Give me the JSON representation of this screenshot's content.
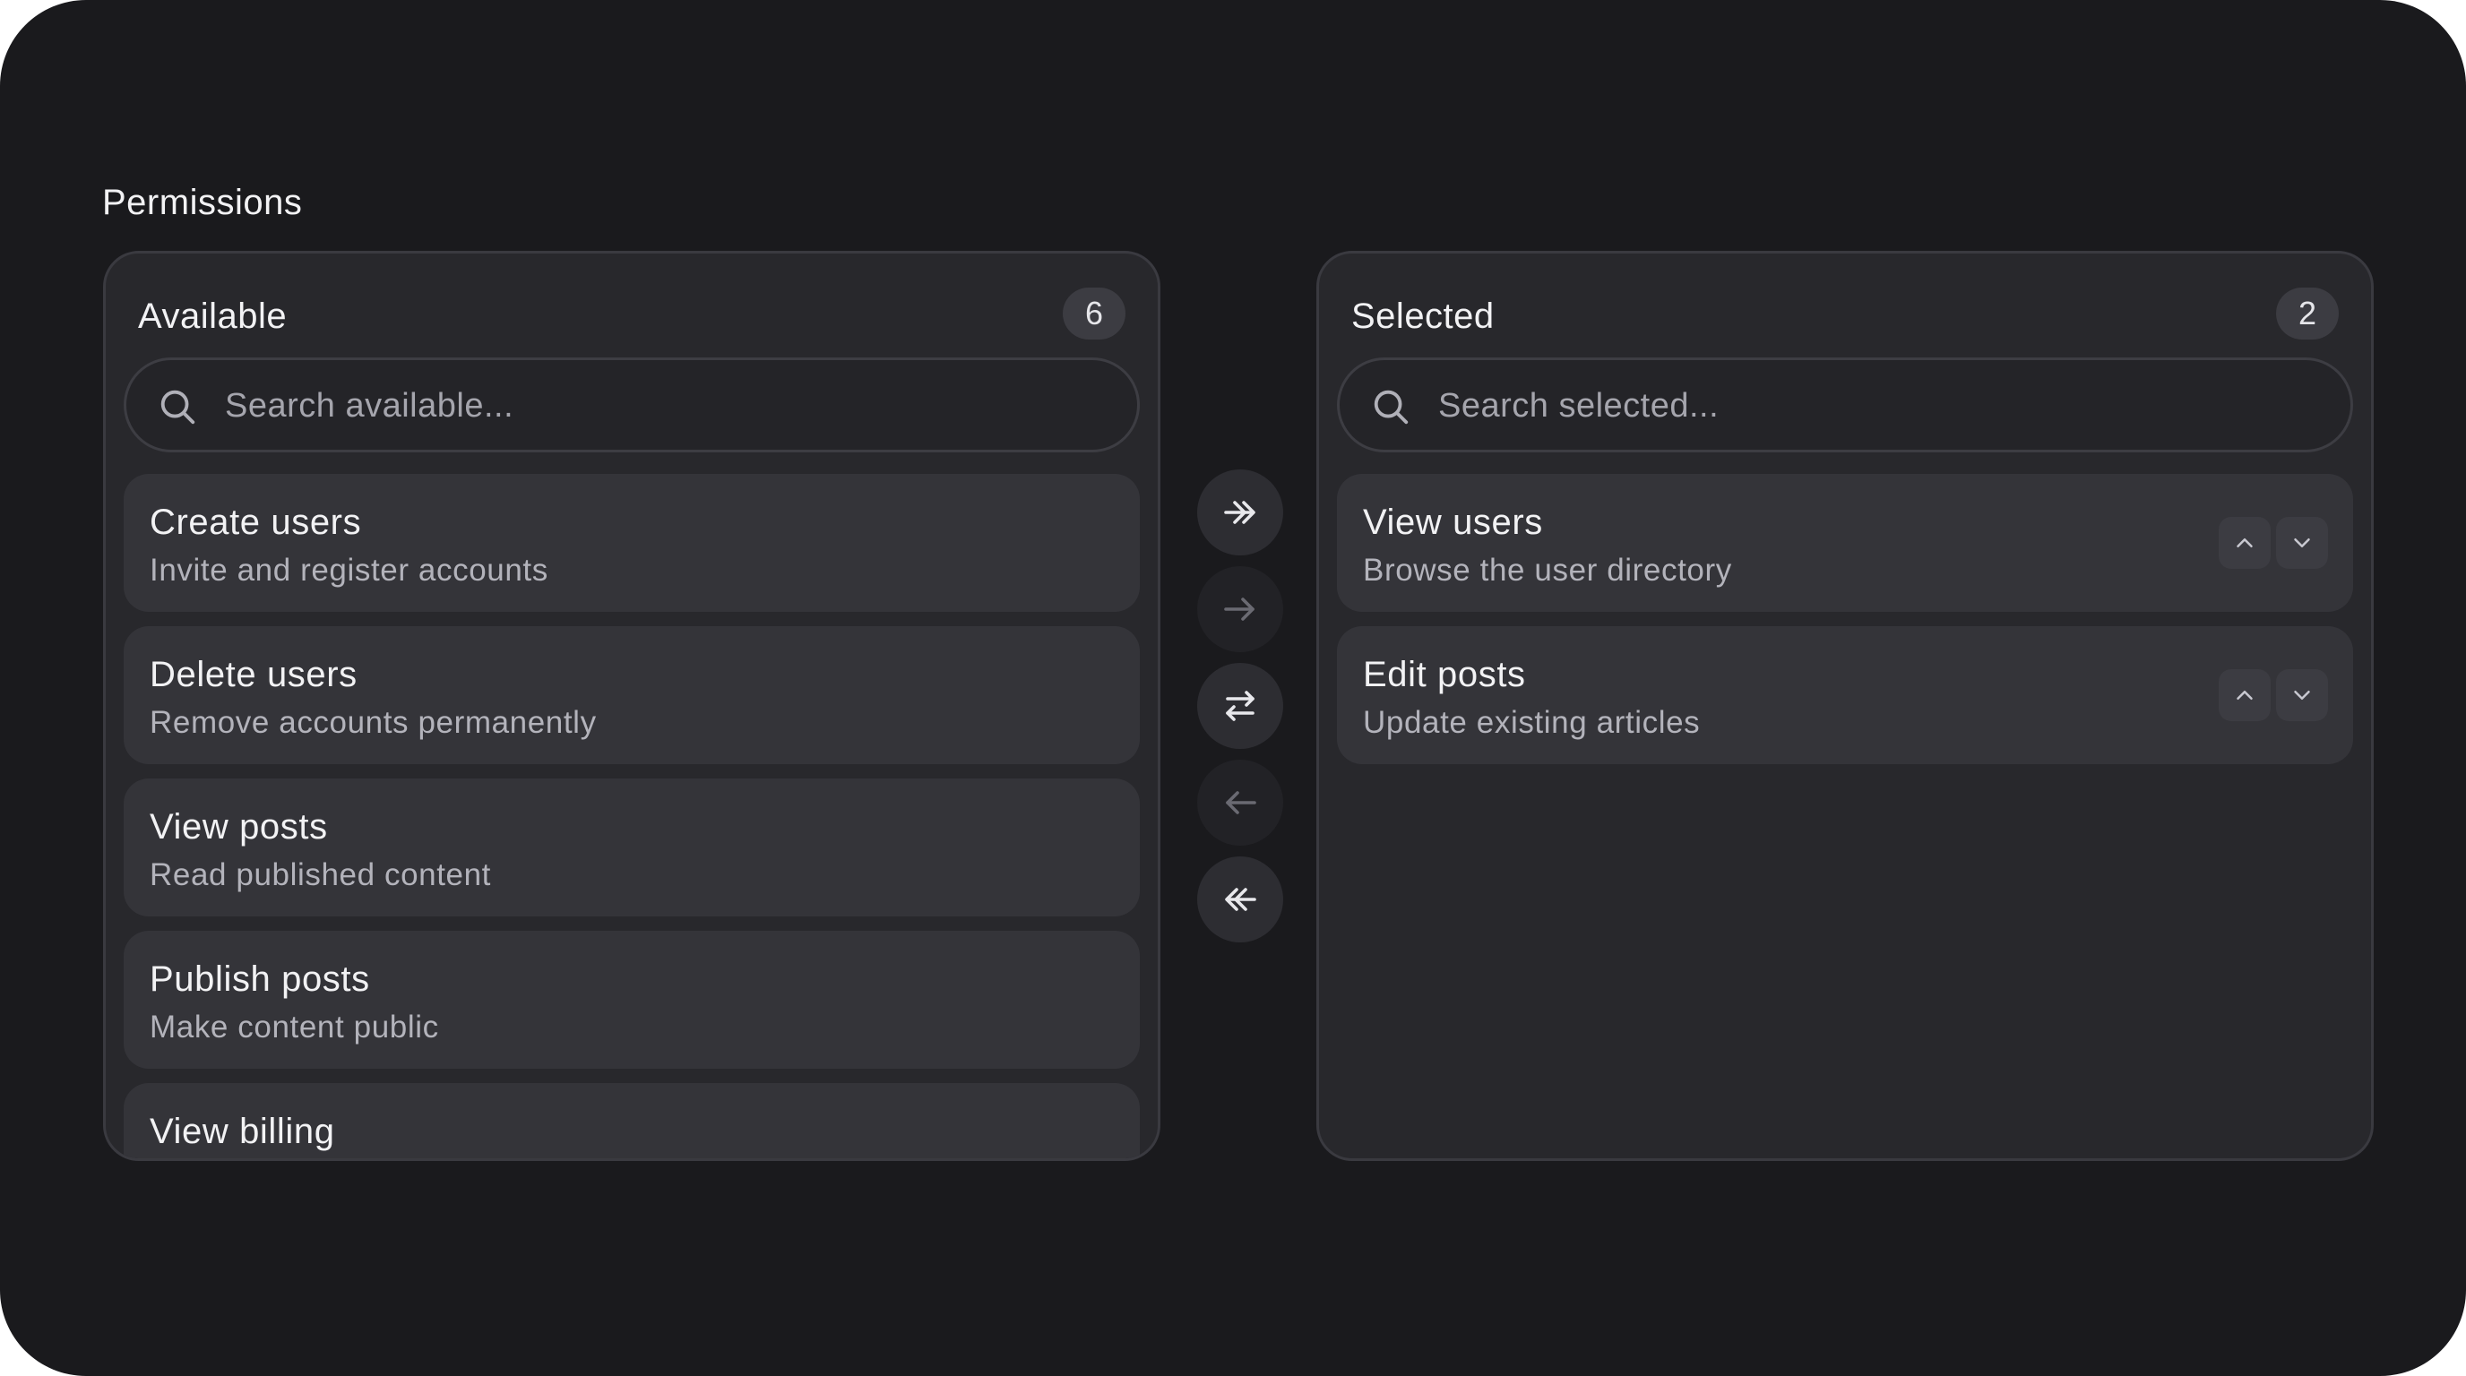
{
  "section": {
    "title": "Permissions"
  },
  "available": {
    "header": "Available",
    "count": "6",
    "search_placeholder": "Search available...",
    "items": [
      {
        "title": "Create users",
        "description": "Invite and register accounts"
      },
      {
        "title": "Delete users",
        "description": "Remove accounts permanently"
      },
      {
        "title": "View posts",
        "description": "Read published content"
      },
      {
        "title": "Publish posts",
        "description": "Make content public"
      },
      {
        "title": "View billing",
        "description": ""
      }
    ]
  },
  "selected": {
    "header": "Selected",
    "count": "2",
    "search_placeholder": "Search selected...",
    "items": [
      {
        "title": "View users",
        "description": "Browse the user directory"
      },
      {
        "title": "Edit posts",
        "description": "Update existing articles"
      }
    ]
  },
  "transfer_controls": [
    {
      "name": "move-all-right",
      "icon": "double-arrow-right-icon",
      "enabled": true
    },
    {
      "name": "move-selected-right",
      "icon": "arrow-right-icon",
      "enabled": false
    },
    {
      "name": "swap",
      "icon": "swap-arrows-icon",
      "enabled": true
    },
    {
      "name": "move-selected-left",
      "icon": "arrow-left-icon",
      "enabled": false
    },
    {
      "name": "move-all-left",
      "icon": "double-arrow-left-icon",
      "enabled": true
    }
  ],
  "colors": {
    "background": "#1a1a1d",
    "panel": "#28282c",
    "item": "#343439",
    "text_primary": "#f2f2f4",
    "text_secondary": "#b3b3bb"
  }
}
